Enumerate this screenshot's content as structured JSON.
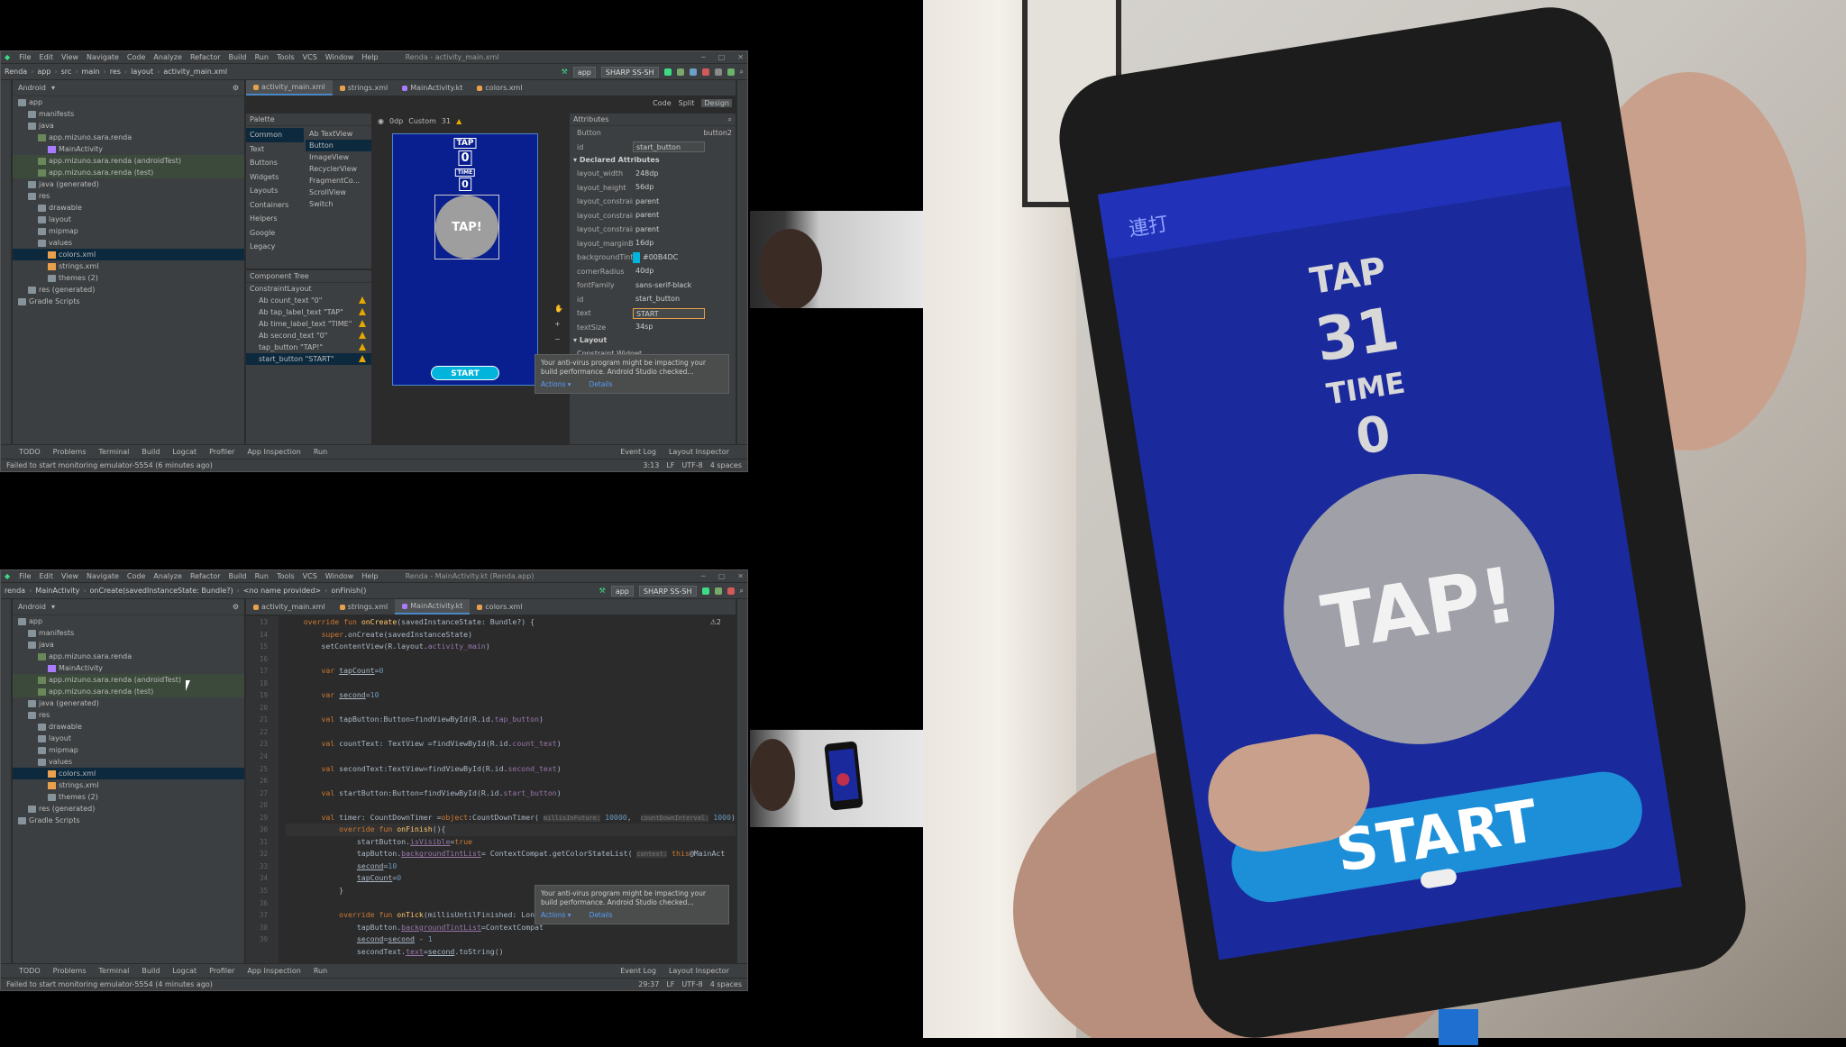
{
  "ide_top": {
    "menu": [
      "File",
      "Edit",
      "View",
      "Navigate",
      "Code",
      "Analyze",
      "Refactor",
      "Build",
      "Run",
      "Tools",
      "VCS",
      "Window",
      "Help"
    ],
    "title": "Renda - activity_main.xml",
    "breadcrumb": [
      "Renda",
      "app",
      "src",
      "main",
      "res",
      "layout",
      "activity_main.xml"
    ],
    "run_config": "app",
    "device": "SHARP SS-SH",
    "project_view": "Android",
    "tabs": [
      "activity_main.xml",
      "strings.xml",
      "MainActivity.kt",
      "colors.xml"
    ],
    "view_modes": [
      "Code",
      "Split",
      "Design"
    ],
    "palette_title": "Palette",
    "palette_categories": [
      "Common",
      "Text",
      "Buttons",
      "Widgets",
      "Layouts",
      "Containers",
      "Helpers",
      "Google",
      "Legacy"
    ],
    "palette_widgets": [
      "Ab TextView",
      "Button",
      "ImageView",
      "RecyclerView",
      "FragmentCo...",
      "ScrollView",
      "Switch"
    ],
    "component_tree_title": "Component Tree",
    "component_tree": [
      "ConstraintLayout",
      "Ab count_text \"0\"",
      "Ab tap_label_text \"TAP\"",
      "Ab time_label_text \"TIME\"",
      "Ab second_text \"0\"",
      "tap_button \"TAP!\"",
      "start_button \"START\""
    ],
    "canvas_toolbar": {
      "device": "Custom",
      "api": "31",
      "dp": "0dp"
    },
    "preview": {
      "tap_label": "TAP",
      "count": "0",
      "time_label": "TIME",
      "second": "0",
      "tap_button": "TAP!",
      "start_button": "START"
    },
    "attributes_title": "Attributes",
    "selected_widget": "Button",
    "selected_id_right": "button2",
    "id_value": "start_button",
    "declared_title": "Declared Attributes",
    "declared": [
      {
        "k": "layout_width",
        "v": "248dp"
      },
      {
        "k": "layout_height",
        "v": "56dp"
      },
      {
        "k": "layout_constrain...",
        "v": "parent"
      },
      {
        "k": "layout_constrain...",
        "v": "parent"
      },
      {
        "k": "layout_constrain...",
        "v": "parent"
      },
      {
        "k": "layout_marginB...",
        "v": "16dp"
      },
      {
        "k": "backgroundTint",
        "v": "#00B4DC"
      },
      {
        "k": "cornerRadius",
        "v": "40dp"
      },
      {
        "k": "fontFamily",
        "v": "sans-serif-black"
      },
      {
        "k": "id",
        "v": "start_button"
      },
      {
        "k": "text",
        "v": "START"
      },
      {
        "k": "textSize",
        "v": "34sp"
      }
    ],
    "layout_title": "Layout",
    "constraint_widget": "Constraint Widget",
    "bottom_tools": [
      "TODO",
      "Problems",
      "Terminal",
      "Build",
      "Logcat",
      "Profiler",
      "App Inspection",
      "Run"
    ],
    "bottom_right": [
      "Event Log",
      "Layout Inspector"
    ],
    "status": "Failed to start monitoring emulator-5554 (6 minutes ago)",
    "status_right": [
      "3:13",
      "LF",
      "UTF-8",
      "4 spaces"
    ]
  },
  "ide_bottom": {
    "title": "Renda - MainActivity.kt (Renda.app)",
    "breadcrumb": [
      "renda",
      "MainActivity",
      "onCreate(savedInstanceState: Bundle?)",
      "<no name provided>",
      "onFinish()"
    ],
    "tabs": [
      "activity_main.xml",
      "strings.xml",
      "MainActivity.kt",
      "colors.xml"
    ],
    "warning_count": "⚠2",
    "line_numbers": [
      "13",
      "14",
      "15",
      "16",
      "17",
      "18",
      "19",
      "20",
      "21",
      "22",
      "23",
      "24",
      "25",
      "26",
      "27",
      "28",
      "29",
      "30",
      "31",
      "32",
      "33",
      "34",
      "35",
      "36",
      "37",
      "38",
      "39"
    ],
    "status": "Failed to start monitoring emulator-5554 (4 minutes ago)",
    "status_right": [
      "29:37",
      "LF",
      "UTF-8",
      "4 spaces"
    ]
  },
  "tree": [
    {
      "label": "app",
      "depth": 0,
      "type": "folder"
    },
    {
      "label": "manifests",
      "depth": 1,
      "type": "folder"
    },
    {
      "label": "java",
      "depth": 1,
      "type": "folder"
    },
    {
      "label": "app.mizuno.sara.renda",
      "depth": 2,
      "type": "pkg"
    },
    {
      "label": "MainActivity",
      "depth": 3,
      "type": "kt"
    },
    {
      "label": "app.mizuno.sara.renda (androidTest)",
      "depth": 2,
      "type": "pkg"
    },
    {
      "label": "app.mizuno.sara.renda (test)",
      "depth": 2,
      "type": "pkg"
    },
    {
      "label": "java (generated)",
      "depth": 1,
      "type": "folder"
    },
    {
      "label": "res",
      "depth": 1,
      "type": "folder"
    },
    {
      "label": "drawable",
      "depth": 2,
      "type": "folder"
    },
    {
      "label": "layout",
      "depth": 2,
      "type": "folder"
    },
    {
      "label": "mipmap",
      "depth": 2,
      "type": "folder"
    },
    {
      "label": "values",
      "depth": 2,
      "type": "folder"
    },
    {
      "label": "colors.xml",
      "depth": 3,
      "type": "xml"
    },
    {
      "label": "strings.xml",
      "depth": 3,
      "type": "xml"
    },
    {
      "label": "themes (2)",
      "depth": 3,
      "type": "folder"
    },
    {
      "label": "res (generated)",
      "depth": 1,
      "type": "folder"
    },
    {
      "label": "Gradle Scripts",
      "depth": 0,
      "type": "folder"
    }
  ],
  "notification": {
    "text": "Your anti-virus program might be impacting your build performance. Android Studio checked...",
    "actions": "Actions ▾",
    "details": "Details"
  },
  "phone": {
    "tap_label": "TAP",
    "count": "31",
    "time_label": "TIME",
    "second": "0",
    "tap_button": "TAP!",
    "start_button": "START",
    "appbar": "連打"
  }
}
